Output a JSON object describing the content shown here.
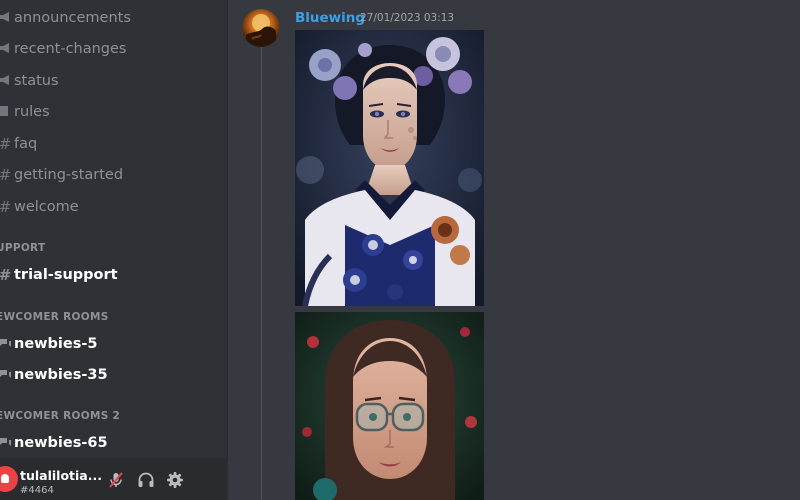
{
  "sidebar": {
    "channels_top": [
      {
        "name": "announcements",
        "icon": "megaphone-icon"
      },
      {
        "name": "recent-changes",
        "icon": "megaphone-icon"
      },
      {
        "name": "status",
        "icon": "megaphone-icon"
      },
      {
        "name": "rules",
        "icon": "book-icon"
      },
      {
        "name": "faq",
        "icon": "hash-icon"
      },
      {
        "name": "getting-started",
        "icon": "hash-icon"
      },
      {
        "name": "welcome",
        "icon": "hash-icon"
      }
    ],
    "categories": [
      {
        "name": "UPPORT",
        "channels": [
          {
            "name": "trial-support",
            "icon": "hash-icon"
          }
        ]
      },
      {
        "name": "EWCOMER ROOMS",
        "channels": [
          {
            "name": "newbies-5",
            "icon": "forum-icon"
          },
          {
            "name": "newbies-35",
            "icon": "forum-icon"
          }
        ]
      },
      {
        "name": "EWCOMER ROOMS 2",
        "channels": [
          {
            "name": "newbies-65",
            "icon": "forum-icon"
          }
        ]
      }
    ]
  },
  "user": {
    "name": "tulalilotia...",
    "tag": "#4464"
  },
  "message": {
    "author": "Bluewing",
    "timestamp": "27/01/2023 03:13"
  },
  "colors": {
    "sidebar": "#2f3136",
    "main": "#36393f",
    "userbar": "#292b2f",
    "author": "#3ba0e8",
    "avatar_red": "#ed4245"
  }
}
